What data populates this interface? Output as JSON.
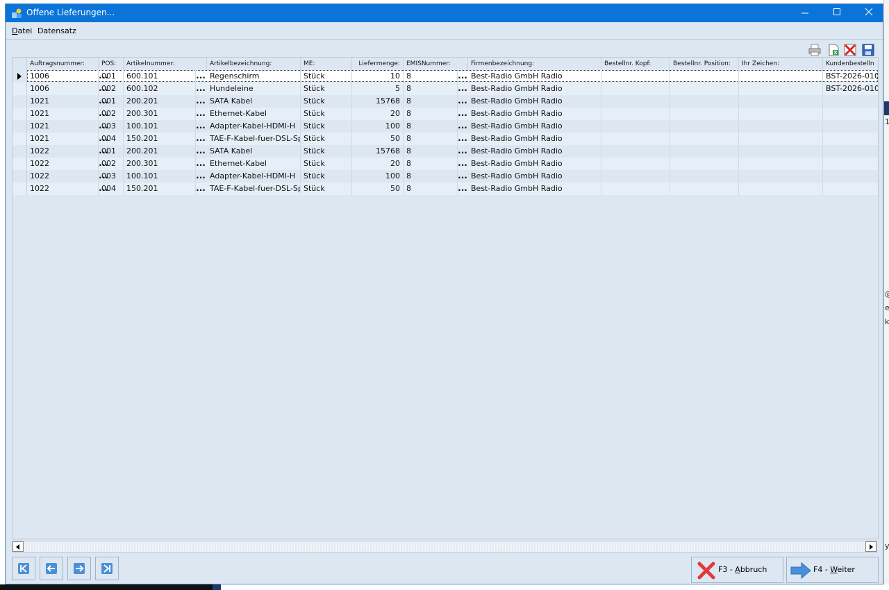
{
  "window": {
    "title": "Offene Lieferungen..."
  },
  "menu": {
    "items": [
      {
        "label": "Datei",
        "underline": "D",
        "rest": "atei"
      },
      {
        "label": "Datensatz"
      }
    ]
  },
  "toolbar": {
    "icons": [
      "printer-icon",
      "export-excel-icon",
      "delete-icon",
      "save-icon"
    ]
  },
  "grid": {
    "columns": [
      "Auftragsnummer:",
      "POS:",
      "Artikelnummer:",
      "Artikelbezeichnung:",
      "ME:",
      "Liefermenge:",
      "EMISNummer:",
      "Firmenbezeichnung:",
      "Bestellnr. Kopf:",
      "Bestellnr. Position:",
      "Ihr Zeichen:",
      "Kundenbestelln"
    ],
    "rows": [
      {
        "auftrag": "1006",
        "pos": "001",
        "artikel": "600.101",
        "bez": "Regenschirm",
        "me": "Stück",
        "menge": "10",
        "emis": "8",
        "firma": "Best-Radio GmbH Radio",
        "kopf": "",
        "position": "",
        "zeichen": "",
        "kunde": "BST-2026-010"
      },
      {
        "auftrag": "1006",
        "pos": "002",
        "artikel": "600.102",
        "bez": "Hundeleine",
        "me": "Stück",
        "menge": "5",
        "emis": "8",
        "firma": "Best-Radio GmbH Radio",
        "kopf": "",
        "position": "",
        "zeichen": "",
        "kunde": "BST-2026-010"
      },
      {
        "auftrag": "1021",
        "pos": "001",
        "artikel": "200.201",
        "bez": "SATA Kabel",
        "me": "Stück",
        "menge": "15768",
        "emis": "8",
        "firma": "Best-Radio GmbH Radio",
        "kopf": "",
        "position": "",
        "zeichen": "",
        "kunde": ""
      },
      {
        "auftrag": "1021",
        "pos": "002",
        "artikel": "200.301",
        "bez": "Ethernet-Kabel",
        "me": "Stück",
        "menge": "20",
        "emis": "8",
        "firma": "Best-Radio GmbH Radio",
        "kopf": "",
        "position": "",
        "zeichen": "",
        "kunde": ""
      },
      {
        "auftrag": "1021",
        "pos": "003",
        "artikel": "100.101",
        "bez": "Adapter-Kabel-HDMI-H",
        "me": "Stück",
        "menge": "100",
        "emis": "8",
        "firma": "Best-Radio GmbH Radio",
        "kopf": "",
        "position": "",
        "zeichen": "",
        "kunde": ""
      },
      {
        "auftrag": "1021",
        "pos": "004",
        "artikel": "150.201",
        "bez": "TAE-F-Kabel-fuer-DSL-Sp",
        "me": "Stück",
        "menge": "50",
        "emis": "8",
        "firma": "Best-Radio GmbH Radio",
        "kopf": "",
        "position": "",
        "zeichen": "",
        "kunde": ""
      },
      {
        "auftrag": "1022",
        "pos": "001",
        "artikel": "200.201",
        "bez": "SATA Kabel",
        "me": "Stück",
        "menge": "15768",
        "emis": "8",
        "firma": "Best-Radio GmbH Radio",
        "kopf": "",
        "position": "",
        "zeichen": "",
        "kunde": ""
      },
      {
        "auftrag": "1022",
        "pos": "002",
        "artikel": "200.301",
        "bez": "Ethernet-Kabel",
        "me": "Stück",
        "menge": "20",
        "emis": "8",
        "firma": "Best-Radio GmbH Radio",
        "kopf": "",
        "position": "",
        "zeichen": "",
        "kunde": ""
      },
      {
        "auftrag": "1022",
        "pos": "003",
        "artikel": "100.101",
        "bez": "Adapter-Kabel-HDMI-H",
        "me": "Stück",
        "menge": "100",
        "emis": "8",
        "firma": "Best-Radio GmbH Radio",
        "kopf": "",
        "position": "",
        "zeichen": "",
        "kunde": ""
      },
      {
        "auftrag": "1022",
        "pos": "004",
        "artikel": "150.201",
        "bez": "TAE-F-Kabel-fuer-DSL-Sp",
        "me": "Stück",
        "menge": "50",
        "emis": "8",
        "firma": "Best-Radio GmbH Radio",
        "kopf": "",
        "position": "",
        "zeichen": "",
        "kunde": ""
      }
    ],
    "selected_row": 0,
    "ellipsis": "..."
  },
  "nav": {
    "buttons": [
      "first-record-icon",
      "previous-record-icon",
      "next-record-icon",
      "last-record-icon"
    ]
  },
  "actions": {
    "cancel": {
      "key": "F3 - ",
      "underline": "A",
      "rest": "bbruch"
    },
    "next": {
      "key": "F4 - ",
      "underline": "W",
      "rest": "eiter"
    }
  },
  "background": {
    "right_texts": [
      "1",
      "@",
      "e",
      "k",
      "y"
    ]
  },
  "colors": {
    "titlebar": "#0a74d8",
    "window_bg": "#dde7f2",
    "row_alt": "#e6eef7",
    "nav_icon": "#4a90d9",
    "cancel_red": "#e23a3a",
    "next_blue": "#4a90d9"
  }
}
